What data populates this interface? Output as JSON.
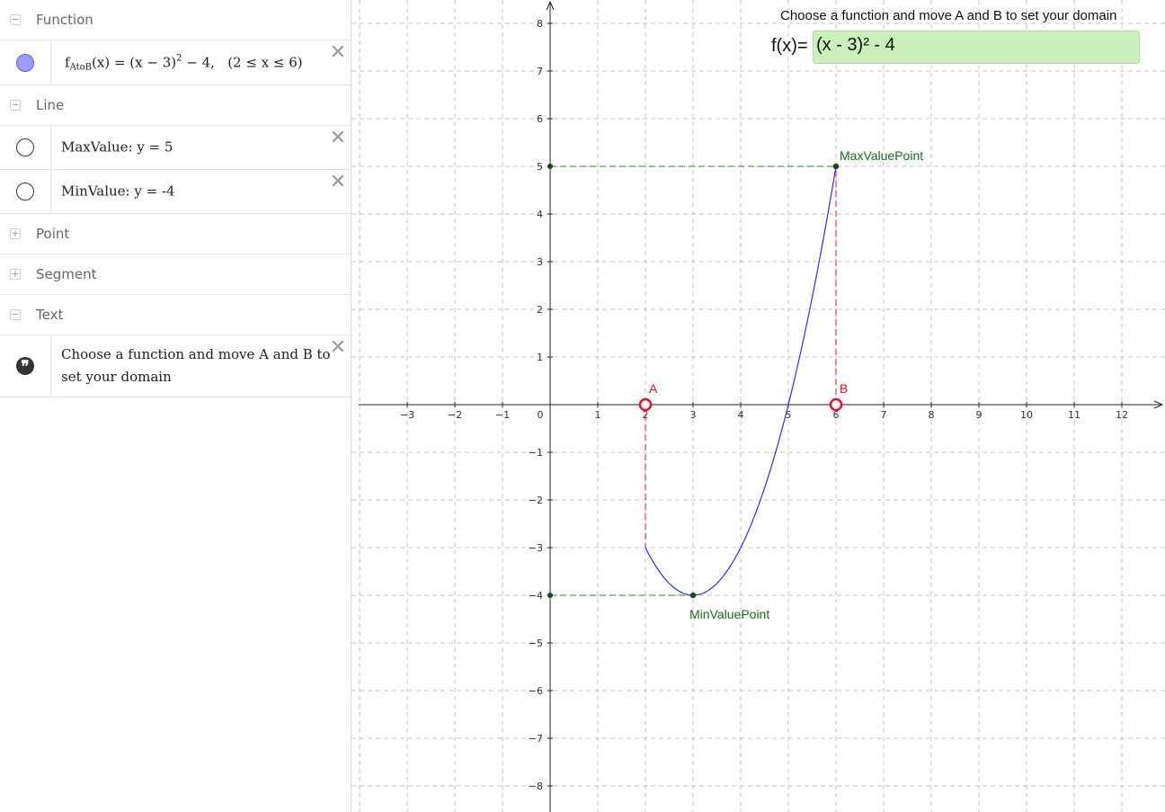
{
  "algebra": {
    "groups": {
      "function": {
        "label": "Function",
        "toggle": "−"
      },
      "line": {
        "label": "Line",
        "toggle": "−"
      },
      "point": {
        "label": "Point",
        "toggle": "+"
      },
      "segment": {
        "label": "Segment",
        "toggle": "+"
      },
      "text": {
        "label": "Text",
        "toggle": "−"
      }
    },
    "function_item": {
      "name": "f",
      "subscript": "AtoB",
      "arg": "(x)",
      "eq": " = ",
      "base": "(x − 3)",
      "exp": "2",
      "rest": " − 4,",
      "domain": "(2 ≤ x ≤ 6)"
    },
    "line_items": [
      {
        "text": "MaxValue: y = 5"
      },
      {
        "text": "MinValue: y = -4"
      }
    ],
    "text_item": {
      "text": "Choose a function and move A and B to set your domain",
      "icon": "❞"
    },
    "close_glyph": "✕"
  },
  "graphics": {
    "instruction": "Choose a function and move A and B to set your domain",
    "fx_label": "f(x)=",
    "fx_value": "(x - 3)² - 4",
    "points": {
      "A": {
        "label": "A",
        "x": 2,
        "y": 0
      },
      "B": {
        "label": "B",
        "x": 6,
        "y": 0
      },
      "max": {
        "label": "MaxValuePoint",
        "x": 6,
        "y": 5
      },
      "min": {
        "label": "MinValuePoint",
        "x": 3,
        "y": -4
      }
    },
    "axis_ticks_x": [
      "−3",
      "−2",
      "−1",
      "0",
      "1",
      "2",
      "3",
      "4",
      "5",
      "6",
      "7",
      "8",
      "9",
      "10",
      "11",
      "12"
    ],
    "axis_ticks_y_pos": [
      "1",
      "2",
      "3",
      "4",
      "5",
      "6",
      "7",
      "8"
    ],
    "axis_ticks_y_neg": [
      "−1",
      "−2",
      "−3",
      "−4",
      "−5",
      "−6",
      "−7",
      "−8"
    ]
  },
  "chart_data": {
    "type": "line",
    "series": [
      {
        "name": "",
        "function": "(x - 3)^2 - 4",
        "x": [
          2,
          3,
          4,
          5,
          6
        ],
        "y": [
          -3,
          -4,
          -3,
          0,
          5
        ]
      }
    ],
    "xlim": [
      -4,
      13
    ],
    "ylim": [
      -8.5,
      8.5
    ],
    "grid": true,
    "colors": {
      "curve": "#3030e0",
      "points_label": "#1a6a1a",
      "ab_points": "#e01030",
      "max_min_guides": "#2a8a2a",
      "ab_guides": "#e01030"
    }
  }
}
